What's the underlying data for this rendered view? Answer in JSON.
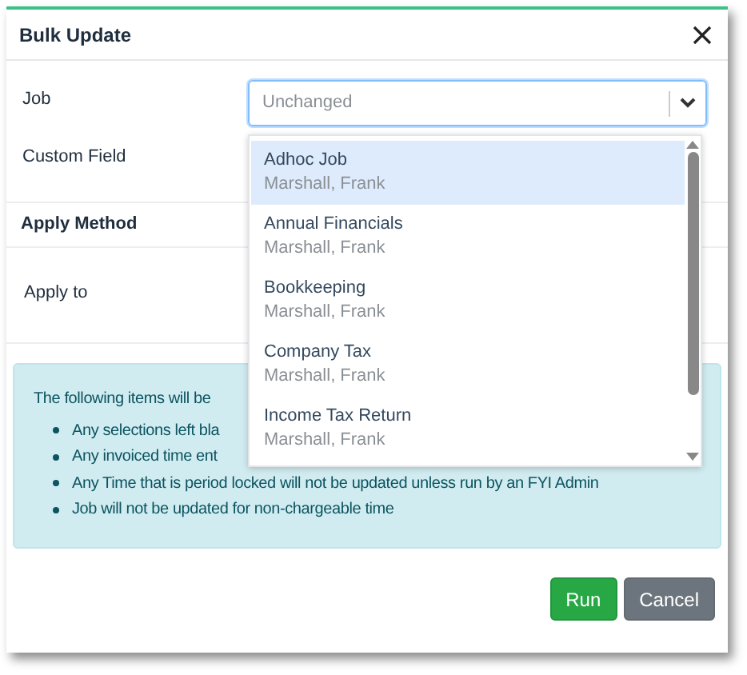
{
  "dialog": {
    "title": "Bulk Update"
  },
  "fields": [
    {
      "label": "Job",
      "kind": "select",
      "placeholder": "Unchanged"
    },
    {
      "label": "Custom Field",
      "kind": "blank"
    }
  ],
  "apply_method": {
    "heading": "Apply Method",
    "fields": [
      {
        "label": "Apply to"
      }
    ]
  },
  "info": {
    "intro": "The following items will be",
    "items": [
      "Any selections left bla",
      "Any invoiced time ent",
      "Any Time that is period locked will not be updated unless run by an FYI Admin",
      "Job will not be updated for non-chargeable time"
    ]
  },
  "dropdown": {
    "items": [
      {
        "title": "Adhoc Job",
        "subtitle": "Marshall, Frank",
        "selected": true
      },
      {
        "title": "Annual Financials",
        "subtitle": "Marshall, Frank",
        "selected": false
      },
      {
        "title": "Bookkeeping",
        "subtitle": "Marshall, Frank",
        "selected": false
      },
      {
        "title": "Company Tax",
        "subtitle": "Marshall, Frank",
        "selected": false
      },
      {
        "title": "Income Tax Return",
        "subtitle": "Marshall, Frank",
        "selected": false
      }
    ]
  },
  "buttons": [
    {
      "label": "Run",
      "kind": "primary"
    },
    {
      "label": "Cancel",
      "kind": "secondary"
    }
  ]
}
